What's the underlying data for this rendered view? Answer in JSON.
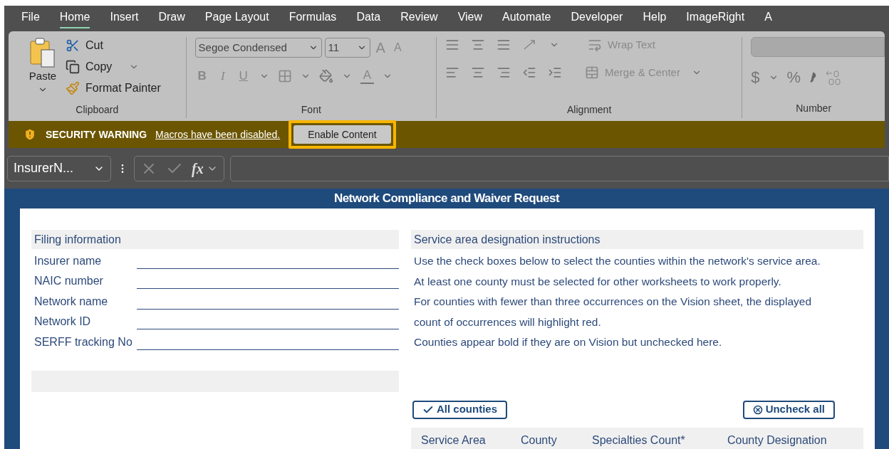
{
  "menu_tabs": [
    {
      "label": "File",
      "selected": false
    },
    {
      "label": "Home",
      "selected": true
    },
    {
      "label": "Insert",
      "selected": false
    },
    {
      "label": "Draw",
      "selected": false
    },
    {
      "label": "Page Layout",
      "selected": false
    },
    {
      "label": "Formulas",
      "selected": false
    },
    {
      "label": "Data",
      "selected": false
    },
    {
      "label": "Review",
      "selected": false
    },
    {
      "label": "View",
      "selected": false
    },
    {
      "label": "Automate",
      "selected": false
    },
    {
      "label": "Developer",
      "selected": false
    },
    {
      "label": "Help",
      "selected": false
    },
    {
      "label": "ImageRight",
      "selected": false
    },
    {
      "label": "A",
      "selected": false
    }
  ],
  "ribbon": {
    "clipboard": {
      "title": "Clipboard",
      "paste": "Paste",
      "cut": "Cut",
      "copy": "Copy",
      "format_painter": "Format Painter"
    },
    "font": {
      "title": "Font",
      "font_name": "Segoe Condensed",
      "font_size": "11",
      "grow": "A",
      "shrink": "A",
      "bold": "B",
      "italic": "I",
      "underline": "U",
      "font_color": "A"
    },
    "alignment": {
      "title": "Alignment",
      "wrap_text": "Wrap Text",
      "merge_center": "Merge & Center"
    },
    "number": {
      "title": "Number",
      "currency": "$",
      "percent": "%"
    }
  },
  "security_bar": {
    "title": "SECURITY WARNING",
    "message": "Macros have been disabled.",
    "button": "Enable Content"
  },
  "formula_bar": {
    "name_box": "InsurerN...",
    "fx": "fx"
  },
  "sheet": {
    "title": "Network Compliance and Waiver Request",
    "filing": {
      "heading": "Filing information",
      "fields": [
        {
          "label": "Insurer name"
        },
        {
          "label": "NAIC number"
        },
        {
          "label": "Network name"
        },
        {
          "label": "Network ID"
        },
        {
          "label": "SERFF tracking No"
        }
      ]
    },
    "instructions": {
      "heading": "Service area designation instructions",
      "lines": [
        "Use the check boxes below to select the counties within the network's service area.",
        "At least one county must be selected for other worksheets to work properly.",
        "For counties with fewer than three occurrences on the Vision sheet, the displayed",
        "count of occurrences will highlight red.",
        "Counties appear bold if they are on Vision but unchecked here."
      ]
    },
    "buttons": [
      {
        "kind": "check",
        "label": "All counties"
      },
      {
        "kind": "uncheck",
        "label": "Uncheck all"
      }
    ],
    "table": {
      "columns": [
        "Service Area",
        "County",
        "Specialties Count*",
        "County Designation"
      ]
    }
  }
}
